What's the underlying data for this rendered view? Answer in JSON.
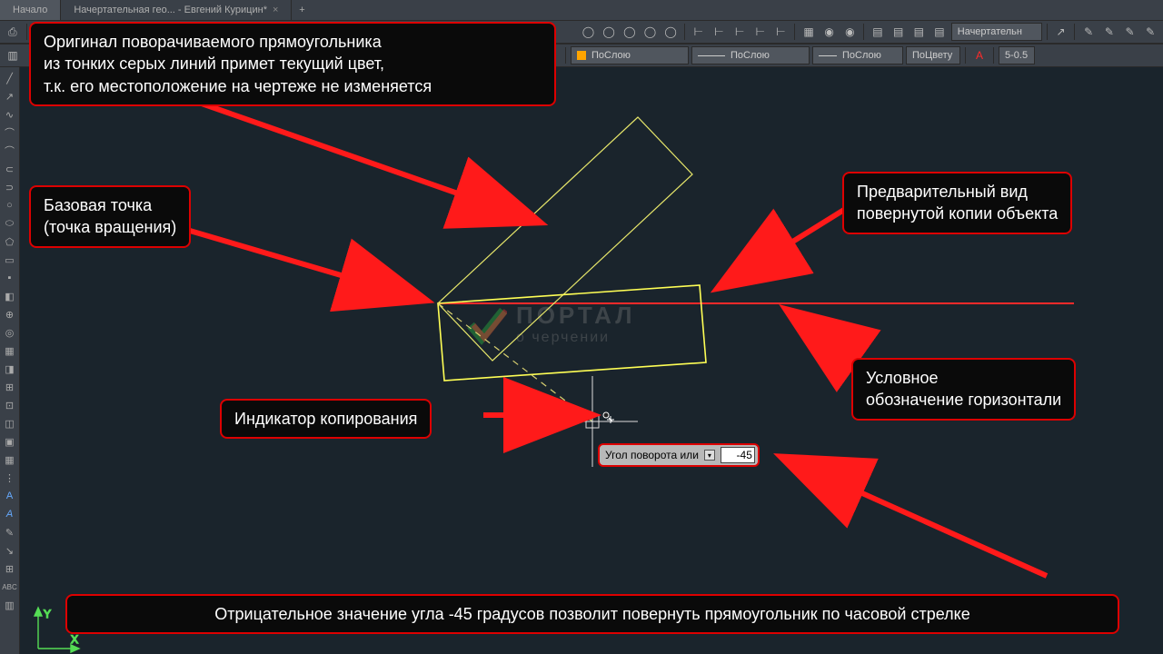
{
  "tabs": {
    "home": "Начало",
    "doc": "Начертательная гео... - Евгений Курицин*"
  },
  "toolbar": {
    "layer": "Начертательн",
    "bylayer1": "ПоСлою",
    "bylayer2": "ПоСлою",
    "bylayer3": "ПоСлою",
    "bycolor": "ПоЦвету",
    "scale": "5-0.5"
  },
  "callouts": {
    "original": "Оригинал поворачиваемого прямоугольника\nиз тонких серых линий примет текущий цвет,\nт.к. его местоположение на чертеже не изменяется",
    "base": "Базовая точка\n(точка вращения)",
    "copyind": "Индикатор копирования",
    "preview": "Предварительный вид\nповернутой копии объекта",
    "horiz": "Условное\nобозначение горизонтали",
    "bottom": "Отрицательное значение угла -45 градусов позволит повернуть прямоугольник по часовой стрелке"
  },
  "dyn": {
    "label": "Угол поворота или",
    "value": "-45"
  },
  "wm": {
    "t1": "ПОРТАЛ",
    "t2": "о черчении"
  },
  "axis": {
    "y": "Y",
    "x": "X"
  }
}
